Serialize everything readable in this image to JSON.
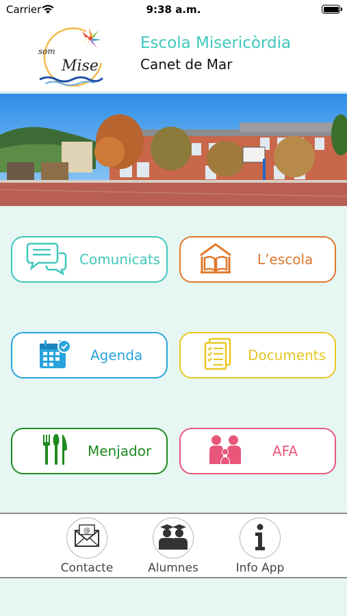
{
  "status_bar": {
    "carrier": "Carrier",
    "time": "9:38 a.m."
  },
  "header": {
    "logo_text_top": "som",
    "logo_text_bottom": "Mise",
    "school_name": "Escola Misericòrdia",
    "town": "Canet de Mar"
  },
  "tiles": [
    {
      "label": "Comunicats",
      "icon": "speech-bubbles-icon",
      "color": "#3fc7bd"
    },
    {
      "label": "L’escola",
      "icon": "school-book-icon",
      "color": "#e0772a"
    },
    {
      "label": "Agenda",
      "icon": "calendar-icon",
      "color": "#29a3db"
    },
    {
      "label": "Documents",
      "icon": "documents-icon",
      "color": "#e8c620"
    },
    {
      "label": "Menjador",
      "icon": "cutlery-icon",
      "color": "#1d8a1f"
    },
    {
      "label": "AFA",
      "icon": "family-icon",
      "color": "#e8577a"
    }
  ],
  "bottom_nav": [
    {
      "label": "Contacte",
      "icon": "envelope-icon"
    },
    {
      "label": "Alumnes",
      "icon": "students-icon"
    },
    {
      "label": "Info App",
      "icon": "info-icon"
    }
  ],
  "colors": {
    "background": "#e6f6f3",
    "accent": "#3fc7bd"
  }
}
